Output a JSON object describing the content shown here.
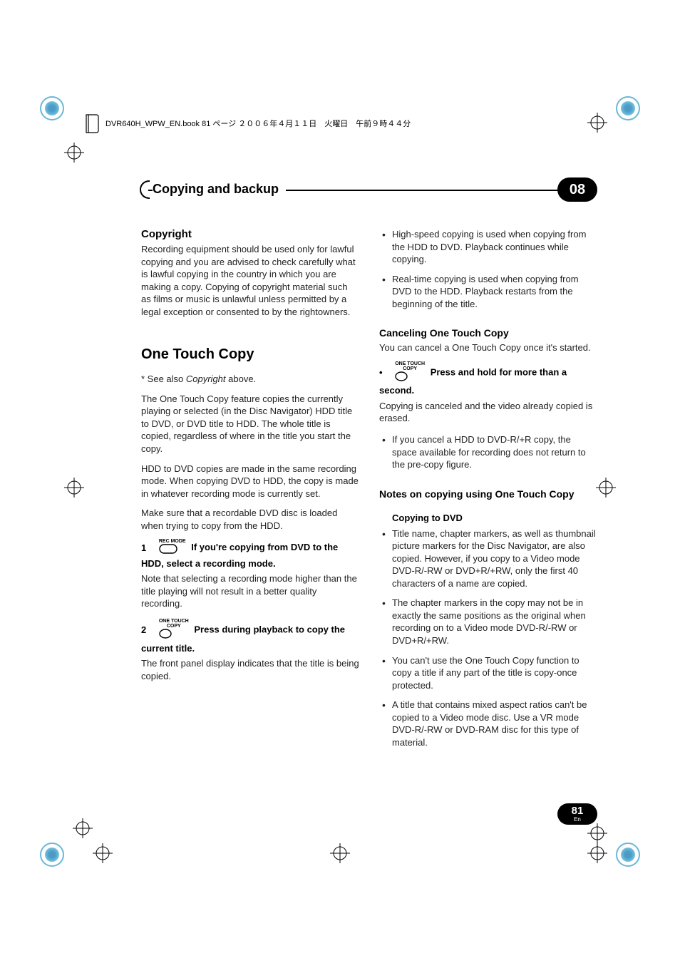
{
  "print_header": "DVR640H_WPW_EN.book  81 ページ  ２００６年４月１１日　火曜日　午前９時４４分",
  "chapter": {
    "title": "Copying and backup",
    "number": "08"
  },
  "left": {
    "copyright_h": "Copyright",
    "copyright_p": "Recording equipment should be used only for lawful copying and you are advised to check carefully what is lawful copying in the country in which you are making a copy. Copying of copyright material such as films or music is unlawful unless permitted by a legal exception or consented to by the rightowners.",
    "otc_h": "One Touch Copy",
    "otc_note_prefix": "* See also ",
    "otc_note_italic": "Copyright",
    "otc_note_suffix": " above.",
    "otc_p1": "The One Touch Copy feature copies the currently playing or selected (in the Disc Navigator) HDD title to DVD, or DVD title to HDD. The whole title is copied, regardless of where in the title you start the copy.",
    "otc_p2": "HDD to DVD copies are made in the same recording mode. When copying DVD to HDD, the copy is made in whatever recording mode is currently set.",
    "otc_p3": "Make sure that a recordable DVD disc is loaded when trying to copy from the HDD.",
    "step1_label": "REC MODE",
    "step1_num": "1",
    "step1_bold": " If you're copying from DVD to the HDD, select a recording mode.",
    "step1_body": "Note that selecting a recording mode higher than the title playing will not result in a better quality recording.",
    "step2_label_a": "ONE TOUCH",
    "step2_label_b": "COPY",
    "step2_num": "2",
    "step2_bold": " Press during playback to copy the current title.",
    "step2_body": "The front panel display indicates that the title is being copied."
  },
  "right": {
    "bul1": "High-speed copying is used when copying from the HDD to DVD. Playback continues while copying.",
    "bul2": "Real-time copying is used when copying from DVD to the HDD. Playback restarts from the beginning of the title.",
    "cancel_h": "Canceling One Touch Copy",
    "cancel_p": "You can cancel a One Touch Copy once it's started.",
    "cancel_label_a": "ONE TOUCH",
    "cancel_label_b": "COPY",
    "cancel_bold": " Press and hold for more than a second.",
    "cancel_body": "Copying is canceled and the video already copied is erased.",
    "cancel_bul": "If you cancel a HDD to DVD-R/+R copy, the space available for recording does not return to the pre-copy figure.",
    "notes_h": "Notes on copying using One Touch Copy",
    "copy_dvd_h": "Copying to DVD",
    "cbul1": "Title name, chapter markers, as well as thumbnail picture markers for the Disc Navigator, are also copied. However, if you copy to a Video mode DVD-R/-RW or DVD+R/+RW, only the first 40 characters of a name are copied.",
    "cbul2": "The chapter markers in the copy may not be in exactly the same positions as the original when recording on to a Video mode DVD-R/-RW or DVD+R/+RW.",
    "cbul3": "You can't use the One Touch Copy function to copy a title if any part of the title is copy-once protected.",
    "cbul4": "A title that contains mixed aspect ratios can't be copied to a Video mode disc. Use a VR mode DVD-R/-RW or DVD-RAM disc for this type of material."
  },
  "footer": {
    "page": "81",
    "lang": "En"
  }
}
